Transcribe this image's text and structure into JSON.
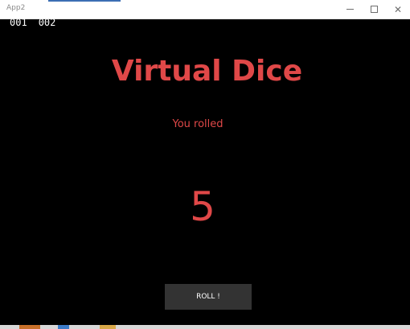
{
  "window": {
    "title": "App2"
  },
  "counters": {
    "first": "001",
    "second": "002"
  },
  "app": {
    "title": "Virtual Dice",
    "rolled_label": "You rolled",
    "roll_value": "5",
    "roll_button_label": "ROLL !"
  },
  "icons": {
    "minimize": "minimize-icon",
    "maximize": "maximize-icon",
    "close": "close-icon"
  },
  "colors": {
    "accent": "#e04848",
    "background": "#000000",
    "button": "#333333",
    "titlebar": "#ffffff"
  }
}
